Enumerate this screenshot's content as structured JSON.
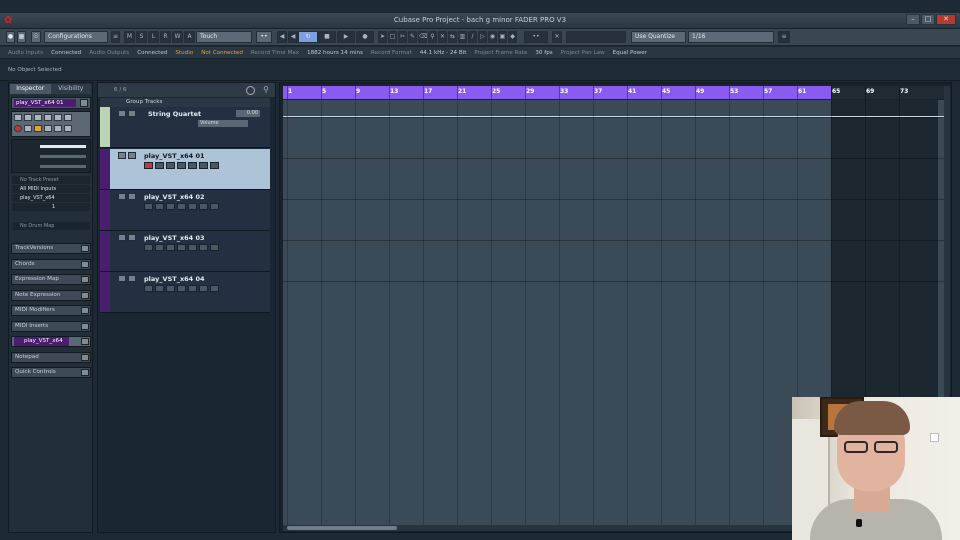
{
  "window": {
    "title": "Cubase Pro Project - bach g minor FADER PRO V3"
  },
  "toolbar": {
    "configurations_label": "Configurations",
    "mode_letters": [
      "M",
      "S",
      "L",
      "R",
      "W",
      "A"
    ],
    "automation_mode": "Touch",
    "quantize_mode": "Use Quantize",
    "quantize_value": "1/16"
  },
  "status": [
    {
      "key": "Audio Inputs",
      "value": "Connected",
      "warn": false
    },
    {
      "key": "Audio Outputs",
      "value": "Connected",
      "warn": false
    },
    {
      "key": "Studio",
      "value": "Not Connected",
      "warn": true
    },
    {
      "key": "Record Time Max",
      "value": "1882 hours 14 mins",
      "warn": false
    },
    {
      "key": "Record Format",
      "value": "44.1 kHz - 24 Bit",
      "warn": false
    },
    {
      "key": "Project Frame Rate",
      "value": "30 fps",
      "warn": false
    },
    {
      "key": "Project Pan Law",
      "value": "Equal Power",
      "warn": false
    }
  ],
  "info_line": "No Object Selected",
  "inspector": {
    "tabs": [
      "Inspector",
      "Visibility"
    ],
    "track_name": "play_VST_x64 01",
    "fields": {
      "track_preset": "No Track Preset",
      "input": "All MIDI Inputs",
      "output": "play_VST_x64",
      "channel": "1",
      "drum_map": "No Drum Map"
    },
    "sections": [
      {
        "label": "TrackVersions",
        "panel": ""
      },
      {
        "label": "Chords",
        "panel": ""
      },
      {
        "label": "Expression Map",
        "panel": ""
      },
      {
        "label": "Note Expression",
        "panel": ""
      },
      {
        "label": "MIDI Modifiers",
        "panel": ""
      },
      {
        "label": "MIDI Inserts",
        "panel": ""
      },
      {
        "label": "",
        "panel": "play_VST_x64"
      },
      {
        "label": "Notepad",
        "panel": ""
      },
      {
        "label": "Quick Controls",
        "panel": ""
      }
    ]
  },
  "tracklist": {
    "count": "6 / 6",
    "group_header": "Group Tracks",
    "group_track": {
      "name": "String Quartet",
      "value": "0.00",
      "automation": "Volume"
    },
    "tracks": [
      {
        "name": "play_VST_x64 01",
        "selected": true
      },
      {
        "name": "play_VST_x64 02",
        "selected": false
      },
      {
        "name": "play_VST_x64 03",
        "selected": false
      },
      {
        "name": "play_VST_x64 04",
        "selected": false
      }
    ]
  },
  "ruler": {
    "bars": [
      "1",
      "5",
      "9",
      "13",
      "17",
      "21",
      "25",
      "29",
      "33",
      "37",
      "41",
      "45",
      "49",
      "53",
      "57",
      "61",
      "65",
      "69",
      "73"
    ],
    "loop_end_bar": 65,
    "loop_color": "#8a5bf0"
  },
  "colors": {
    "accent": "#8a5bf0",
    "track_color": "#4a1d6f",
    "warning": "#e7a33a",
    "record": "#c23838"
  }
}
